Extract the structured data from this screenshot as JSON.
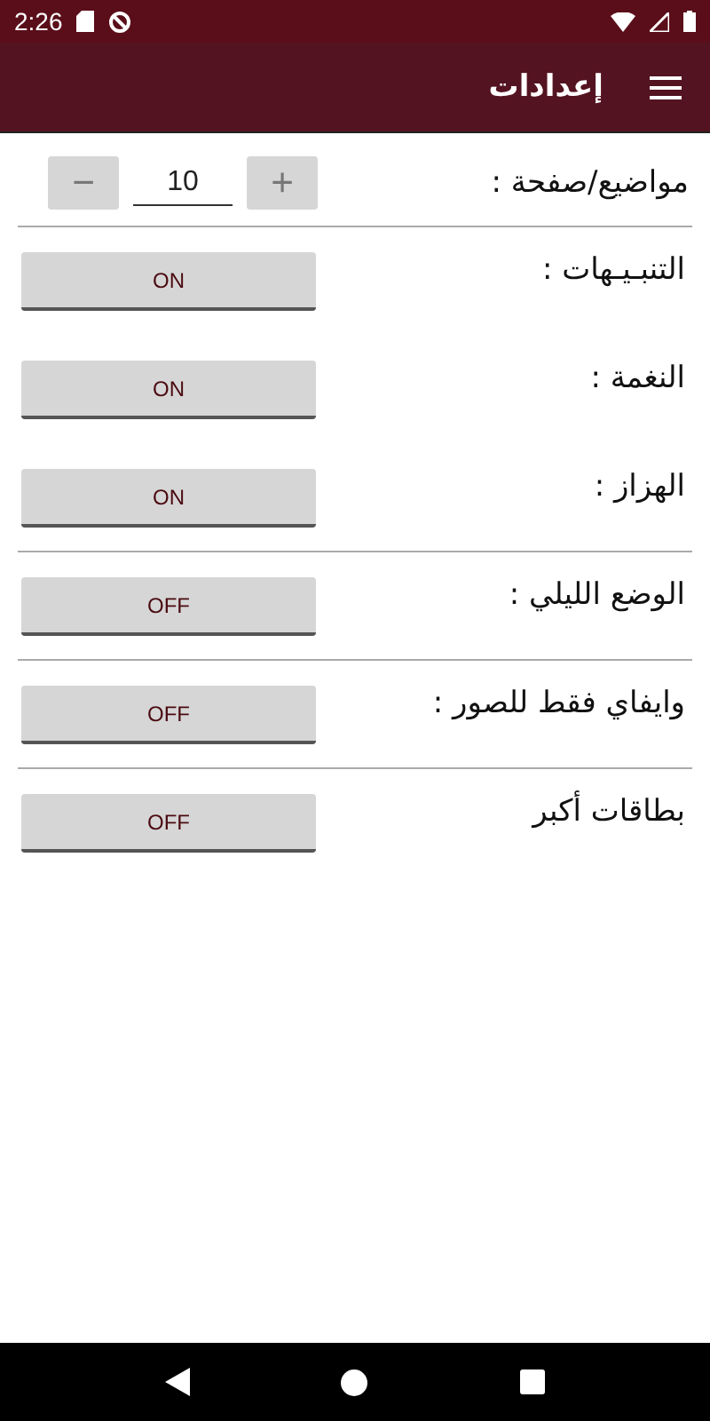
{
  "status_bar": {
    "time": "2:26"
  },
  "app_bar": {
    "title": "إعدادات"
  },
  "stepper": {
    "label": "مواضيع/صفحة :",
    "value": "10",
    "minus": "−",
    "plus": "+"
  },
  "settings": [
    {
      "label": "التنبـيـهات :",
      "button": "ON",
      "divider_after": false
    },
    {
      "label": "النغمة :",
      "button": "ON",
      "divider_after": false
    },
    {
      "label": "الهزاز :",
      "button": "ON",
      "divider_after": true
    },
    {
      "label": "الوضع الليلي :",
      "button": "OFF",
      "divider_after": true
    },
    {
      "label": "وايفاي فقط للصور :",
      "button": "OFF",
      "divider_after": true
    },
    {
      "label": "بطاقات أكبر",
      "button": "OFF",
      "divider_after": false
    }
  ]
}
